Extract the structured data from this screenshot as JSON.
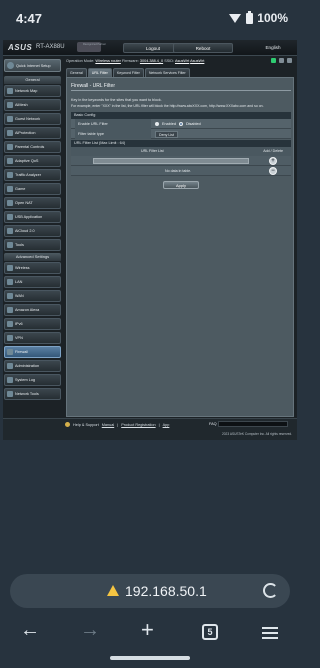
{
  "status_bar": {
    "time": "4:47",
    "battery": "100%"
  },
  "router": {
    "header": {
      "brand": "ASUS",
      "model": "RT-AX88U",
      "logo_text": "Recognized Partner",
      "logout_label": "Logout",
      "reboot_label": "Reboot",
      "language": "English"
    },
    "op_bar": {
      "op_mode_label": "Operation Mode:",
      "op_mode_value": "Wireless router",
      "firmware_label": "Firmware:",
      "firmware_value": "3004.388.4_0",
      "ssid_label": "SSID:",
      "ssid_1": "AsusWrt",
      "ssid_2": "AsusWrt"
    },
    "sidebar": {
      "quick_setup": "Quick Internet Setup",
      "general_title": "General",
      "general_items": [
        "Network Map",
        "AiMesh",
        "Guest Network",
        "AiProtection",
        "Parental Controls",
        "Adaptive QoS",
        "Traffic Analyzer",
        "Game",
        "Open NAT",
        "USB Application",
        "AiCloud 2.0",
        "Tools"
      ],
      "advanced_title": "Advanced Settings",
      "advanced_items": [
        "Wireless",
        "LAN",
        "WAN",
        "Amazon Alexa",
        "IPv6",
        "VPN",
        "Firewall",
        "Administration",
        "System Log",
        "Network Tools"
      ],
      "active_item": "Firewall"
    },
    "tabs": [
      "General",
      "URL Filter",
      "Keyword Filter",
      "Network Services Filter"
    ],
    "active_tab": "URL Filter",
    "panel": {
      "title": "Firewall - URL Filter",
      "desc1": "Key in the keywords for the sites that you want to block.",
      "desc2": "For example, enter \"XXX\" in the list, the URL filter will block the http://www.abcXXX.com, http://www.XXXabc.com and so on.",
      "basic_config_title": "Basic Config",
      "enable_label": "Enable URL Filter",
      "enabled_option": "Enabled",
      "disabled_option": "Disabled",
      "filter_type_label": "Filter table type",
      "filter_type_value": "Deny List",
      "list_title": "URL Filter List (Max Limit : 64)",
      "col_url": "URL Filter List",
      "col_action": "Add / Delete",
      "no_data": "No data in table.",
      "apply_label": "Apply"
    },
    "footer": {
      "help_label": "Help & Support",
      "links": [
        "Manual",
        "Product Registration",
        "App"
      ],
      "faq_label": "FAQ",
      "copyright": "2023 ASUSTeK Computer Inc. All rights reserved."
    }
  },
  "browser": {
    "url": "192.168.50.1",
    "tab_count": "5"
  }
}
